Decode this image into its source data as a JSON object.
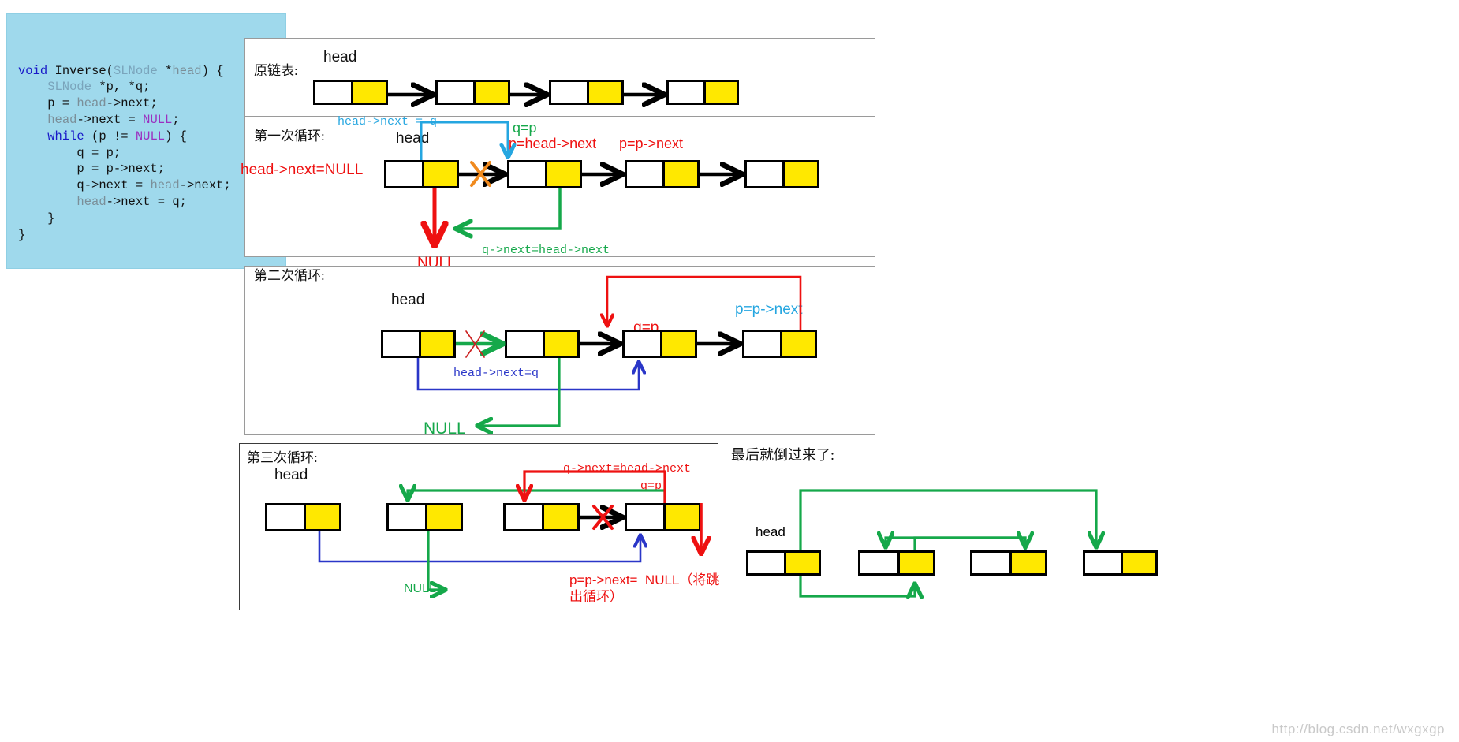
{
  "code": {
    "lines": [
      [
        {
          "t": "void ",
          "c": "kw"
        },
        {
          "t": "Inverse",
          "c": "plain"
        },
        {
          "t": "(",
          "c": "plain"
        },
        {
          "t": "SLNode ",
          "c": "type"
        },
        {
          "t": "*",
          "c": "plain"
        },
        {
          "t": "head",
          "c": "dim"
        },
        {
          "t": ") {",
          "c": "plain"
        }
      ],
      [
        {
          "t": "    SLNode ",
          "c": "type"
        },
        {
          "t": "*p, *q;",
          "c": "plain"
        }
      ],
      [
        {
          "t": "    p = ",
          "c": "plain"
        },
        {
          "t": "head",
          "c": "dim"
        },
        {
          "t": "->next;",
          "c": "plain"
        }
      ],
      [
        {
          "t": "    ",
          "c": "plain"
        },
        {
          "t": "head",
          "c": "dim"
        },
        {
          "t": "->next = ",
          "c": "plain"
        },
        {
          "t": "NULL",
          "c": "null"
        },
        {
          "t": ";",
          "c": "plain"
        }
      ],
      [
        {
          "t": "    ",
          "c": "plain"
        },
        {
          "t": "while",
          "c": "kw"
        },
        {
          "t": " (p != ",
          "c": "plain"
        },
        {
          "t": "NULL",
          "c": "null"
        },
        {
          "t": ") {",
          "c": "plain"
        }
      ],
      [
        {
          "t": "        q = p;",
          "c": "plain"
        }
      ],
      [
        {
          "t": "        p = p->next;",
          "c": "plain"
        }
      ],
      [
        {
          "t": "        q->next = ",
          "c": "plain"
        },
        {
          "t": "head",
          "c": "dim"
        },
        {
          "t": "->next;",
          "c": "plain"
        }
      ],
      [
        {
          "t": "        ",
          "c": "plain"
        },
        {
          "t": "head",
          "c": "dim"
        },
        {
          "t": "->next = q;",
          "c": "plain"
        }
      ],
      [
        {
          "t": "    }",
          "c": "plain"
        }
      ],
      [
        {
          "t": "}",
          "c": "plain"
        }
      ]
    ]
  },
  "panel1": {
    "caption": "原链表:",
    "head_label": "head"
  },
  "panel2": {
    "caption": "第一次循环:",
    "head_label": "head",
    "lbl_head_next_q": "head->next = q",
    "lbl_q_eq_p": "q=p",
    "lbl_p_eq_head_next": "p=head->next",
    "lbl_p_eq_p_next": "p=p->next",
    "lbl_head_next_null": "head->next=NULL",
    "lbl_null": "NULL",
    "lbl_q_next_head_next": "q->next=head->next"
  },
  "panel3": {
    "caption": "第二次循环:",
    "head_label": "head",
    "lbl_q_eq_p": "q=p",
    "lbl_p_eq_p_next": "p=p->next",
    "lbl_head_next_q": "head->next=q",
    "lbl_null": "NULL"
  },
  "panel4": {
    "caption": "第三次循环:",
    "head_label": "head",
    "lbl_q_next_head_next": "q->next=head->next",
    "lbl_q_eq_p": "q=p",
    "lbl_null": "NULL",
    "lbl_p_eq_p_next_line1": "p=p->next=  NULL（将跳",
    "lbl_p_eq_p_next_line2": "出循环）"
  },
  "panel5": {
    "caption": "最后就倒过来了:",
    "head_label": "head"
  },
  "watermark": "http://blog.csdn.net/wxgxgp",
  "colors": {
    "node_fill": "#ffe800",
    "code_bg": "#9fd9ec",
    "red": "#ee1111",
    "green": "#15a84a",
    "blue": "#2a36c8",
    "cyan": "#25a6e0",
    "orange": "#f08a1e"
  }
}
